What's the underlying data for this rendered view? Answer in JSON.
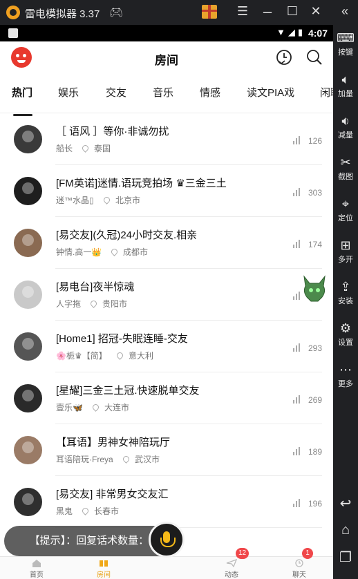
{
  "emulator": {
    "title": "雷电模拟器 3.37",
    "sidebar": [
      {
        "icon": "keyboard-icon",
        "label": "按键"
      },
      {
        "icon": "volume-up-icon",
        "label": "加量"
      },
      {
        "icon": "volume-down-icon",
        "label": "减量"
      },
      {
        "icon": "scissors-icon",
        "label": "截图"
      },
      {
        "icon": "location-pin-icon",
        "label": "定位"
      },
      {
        "icon": "multi-open-icon",
        "label": "多开"
      },
      {
        "icon": "apk-install-icon",
        "label": "安装"
      },
      {
        "icon": "gear-icon",
        "label": "设置"
      },
      {
        "icon": "more-dots-icon",
        "label": "更多"
      }
    ]
  },
  "statusbar": {
    "time": "4:07"
  },
  "header": {
    "title": "房间"
  },
  "tabs": [
    {
      "label": "热门",
      "active": true
    },
    {
      "label": "娱乐"
    },
    {
      "label": "交友"
    },
    {
      "label": "音乐"
    },
    {
      "label": "情感"
    },
    {
      "label": "读文PIA戏"
    },
    {
      "label": "闲聊"
    }
  ],
  "rooms": [
    {
      "title": "［ 语风 ］等你·非诚勿扰",
      "host": "船长",
      "location": "泰国",
      "count": "126",
      "avatar_color": "#3a3a3a"
    },
    {
      "title": "[FM英诺]迷情.语玩竞拍场 ♛三金三土",
      "host": "迷™水晶▯",
      "location": "北京市",
      "count": "303",
      "avatar_color": "#1e1e1e"
    },
    {
      "title": "[易交友](久冠)24小时交友.相亲",
      "host": "钟情.高一👑",
      "location": "成都市",
      "count": "174",
      "avatar_color": "#8a6a52"
    },
    {
      "title": "[易电台]夜半惊魂",
      "host": "人字拖",
      "location": "贵阳市",
      "count": "129",
      "avatar_color": "#c9c9c9"
    },
    {
      "title": "[Home1] 招冠-失眠连睡-交友",
      "host": "🌸栀♛【简】",
      "location": "意大利",
      "count": "293",
      "avatar_color": "#555555"
    },
    {
      "title": "[星耀]三金三土冠.快速脱单交友",
      "host": "壹乐🦋",
      "location": "大连市",
      "count": "269",
      "avatar_color": "#2a2a2a"
    },
    {
      "title": "【耳语】男神女神陪玩厅",
      "host": "耳语陪玩·Freya",
      "location": "武汉市",
      "count": "189",
      "avatar_color": "#9a7b66"
    },
    {
      "title": "[易交友] 非常男女交友汇",
      "host": "黑鬼",
      "location": "长春市",
      "count": "196",
      "avatar_color": "#2f2f2f"
    }
  ],
  "bottom_nav": [
    {
      "label": "首页",
      "icon": "home-icon"
    },
    {
      "label": "房间",
      "icon": "room-icon",
      "active": true
    },
    {
      "label": "动态",
      "icon": "paper-plane-icon",
      "badge": "12"
    },
    {
      "label": "聊天",
      "icon": "chat-clock-icon",
      "badge": "1"
    }
  ],
  "toast": {
    "text": "【提示】：回复话术数量：1"
  },
  "colors": {
    "accent": "#f5b918",
    "badge": "#f0474a",
    "tab_text": "#222222"
  }
}
